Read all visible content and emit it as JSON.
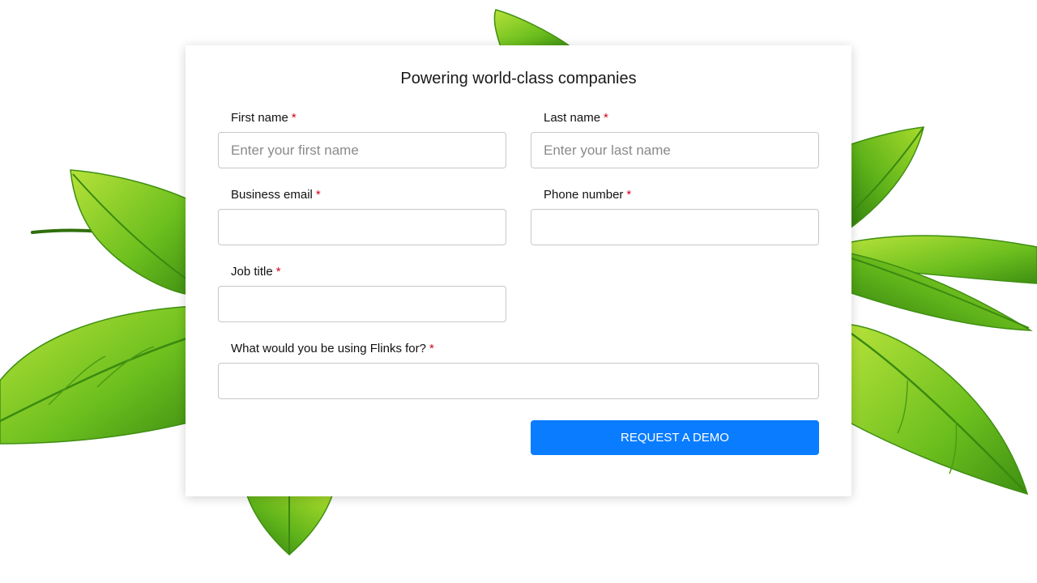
{
  "form": {
    "title": "Powering world-class companies",
    "required_marker": "*",
    "fields": {
      "first_name": {
        "label": "First name",
        "placeholder": "Enter your first name",
        "value": ""
      },
      "last_name": {
        "label": "Last name",
        "placeholder": "Enter your last name",
        "value": ""
      },
      "business_email": {
        "label": "Business email",
        "placeholder": "",
        "value": ""
      },
      "phone_number": {
        "label": "Phone number",
        "placeholder": "",
        "value": ""
      },
      "job_title": {
        "label": "Job title",
        "placeholder": "",
        "value": ""
      },
      "usage": {
        "label": "What would you be using Flinks for?",
        "placeholder": "",
        "value": ""
      }
    },
    "submit_label": "REQUEST A DEMO"
  },
  "colors": {
    "accent": "#0a7cff",
    "required": "#d0021b",
    "leaf_light": "#9bd51f",
    "leaf_dark": "#3f8f12"
  },
  "icons": {
    "background": "green-leaves-background"
  }
}
